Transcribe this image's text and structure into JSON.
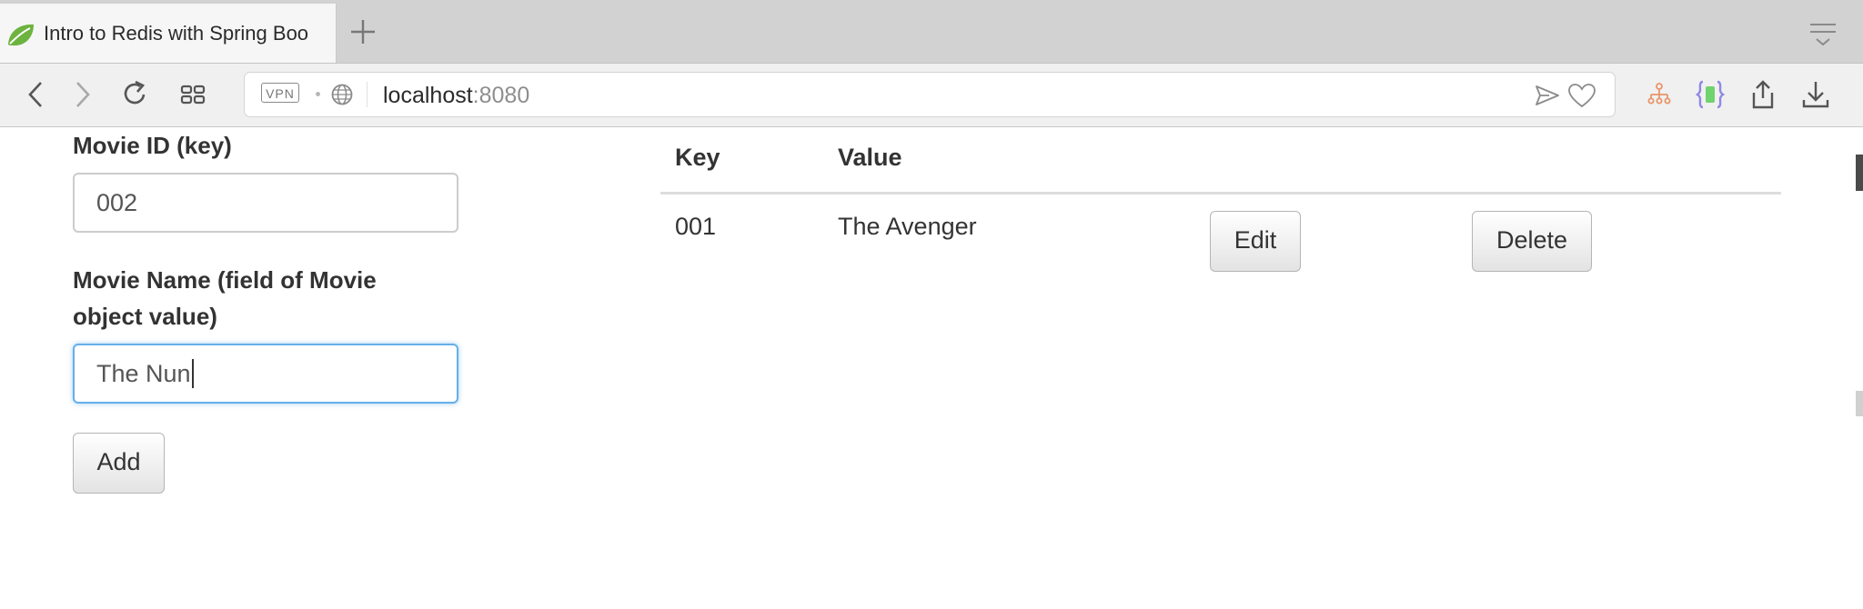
{
  "browser": {
    "tab_title": "Intro to Redis with Spring Boo",
    "url_host": "localhost",
    "url_port": ":8080",
    "vpn_label": "VPN"
  },
  "form": {
    "movie_id_label": "Movie ID (key)",
    "movie_id_value": "002",
    "movie_name_label_line1": "Movie Name (field of Movie",
    "movie_name_label_line2": "object value)",
    "movie_name_value": "The Nun",
    "add_label": "Add"
  },
  "table": {
    "headers": [
      "Key",
      "Value"
    ],
    "rows": [
      {
        "key": "001",
        "value": "The Avenger",
        "edit_label": "Edit",
        "delete_label": "Delete"
      }
    ]
  },
  "colors": {
    "focus_border": "#66afe9",
    "spring_leaf": "#6db33f"
  }
}
